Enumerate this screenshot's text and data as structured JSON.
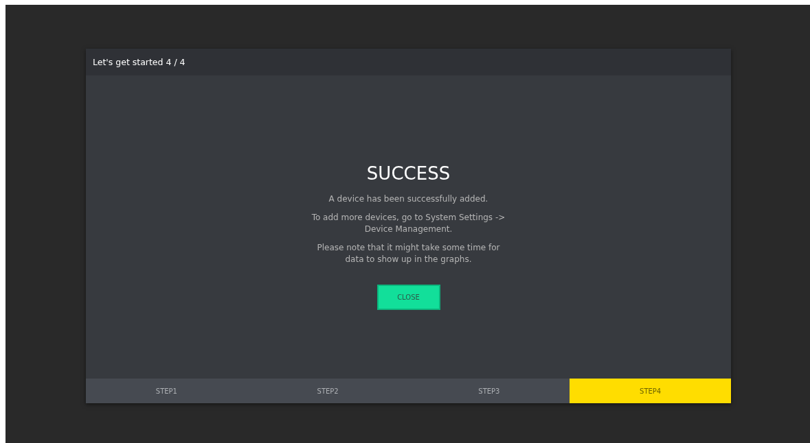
{
  "dialog": {
    "title": "Let's get started 4 / 4",
    "heading": "SUCCESS",
    "paragraphs": [
      "A device has been successfully added.",
      "To add more devices, go to System Settings -> Device Management.",
      "Please note that it might take some time for data to show up in the graphs."
    ],
    "button": "CLOSE",
    "steps": [
      {
        "label": "STEP1",
        "selected": false
      },
      {
        "label": "STEP2",
        "selected": false
      },
      {
        "label": "STEP3",
        "selected": false
      },
      {
        "label": "STEP4",
        "selected": true
      }
    ]
  }
}
